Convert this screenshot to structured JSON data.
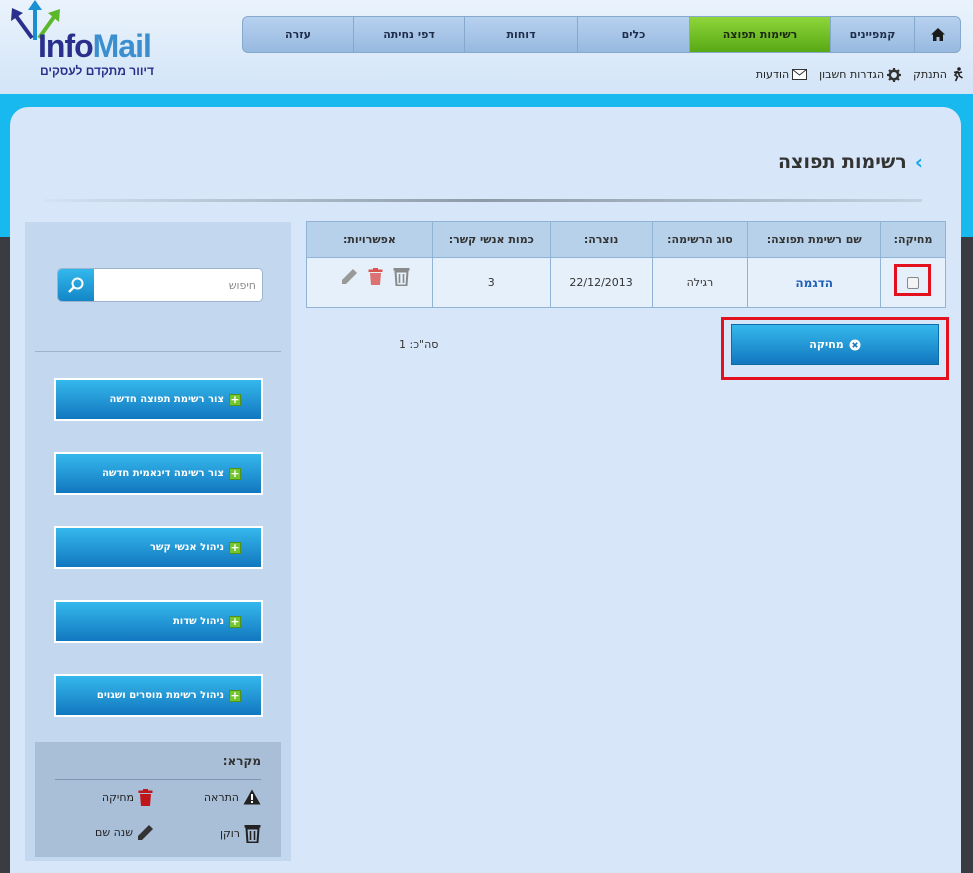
{
  "brand": {
    "logo_info": "Info",
    "logo_mail": "Mail",
    "tagline": "דיוור מתקדם לעסקים"
  },
  "nav": {
    "home_icon": "home-icon",
    "tabs": [
      {
        "label": "קמפיינים",
        "active": false
      },
      {
        "label": "רשימות תפוצה",
        "active": true
      },
      {
        "label": "כלים",
        "active": false
      },
      {
        "label": "דוחות",
        "active": false
      },
      {
        "label": "דפי נחיתה",
        "active": false
      },
      {
        "label": "עזרה",
        "active": false
      }
    ]
  },
  "userbar": {
    "messages": "הודעות",
    "settings": "הגדרות חשבון",
    "logout": "התנתק"
  },
  "page": {
    "title": "רשימות תפוצה"
  },
  "sidebar": {
    "search_placeholder": "חיפוש",
    "buttons": [
      "צור רשימת תפוצה חדשה",
      "צור רשימה דינאמית חדשה",
      "ניהול אנשי קשר",
      "ניהול שדות",
      "ניהול רשימת מוסרים ושגוים"
    ],
    "legend": {
      "title": "מקרא:",
      "warning": "התראה",
      "delete": "מחיקה",
      "empty": "רוקן",
      "rename": "שנה שם"
    }
  },
  "table": {
    "headers": [
      "מחיקה:",
      "שם רשימת תפוצה:",
      "סוג הרשימה:",
      "נוצרה:",
      "כמות אנשי קשר:",
      "אפשרויות:"
    ],
    "rows": [
      {
        "name": "הדגמה",
        "type": "רגילה",
        "created": "22/12/2013",
        "count": "3"
      }
    ]
  },
  "actions": {
    "delete_label": "מחיקה",
    "total": "סה\"כ: 1"
  },
  "colors": {
    "accent_blue": "#17b9ef",
    "active_tab_green": "#58a815",
    "highlight_red": "#e3101e",
    "delete_icon_red": "#d9534f"
  }
}
